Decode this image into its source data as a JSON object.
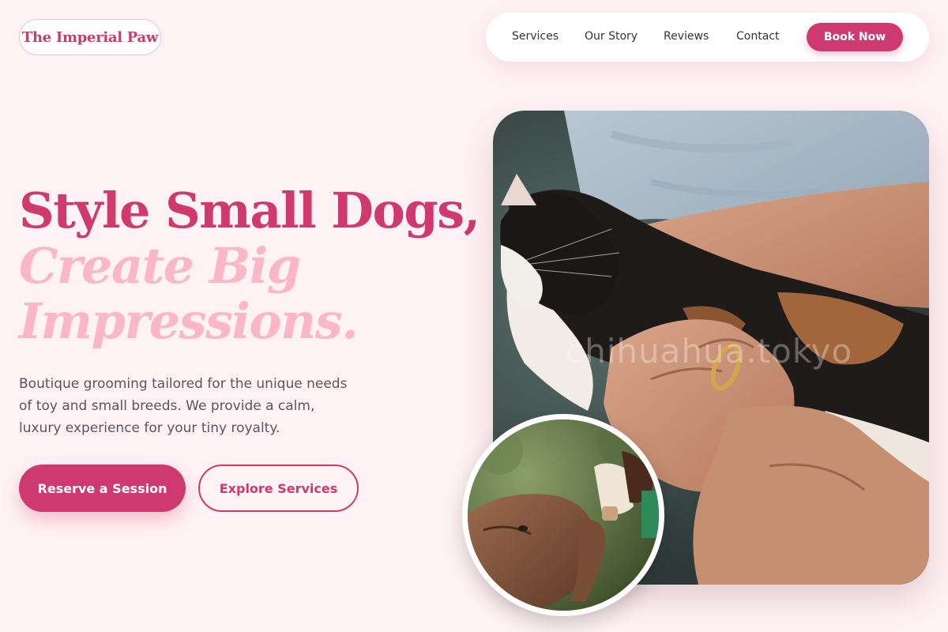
{
  "brand": {
    "name": "The Imperial Paw"
  },
  "nav": {
    "links": [
      "Services",
      "Our Story",
      "Reviews",
      "Contact"
    ],
    "cta": "Book Now"
  },
  "hero": {
    "headline_line1": "Style Small Dogs,",
    "headline_line2": "Create Big",
    "headline_line3": "Impressions.",
    "description_lines": [
      "Boutique grooming tailored for the unique needs",
      "of toy and small breeds. We provide a calm,",
      "luxury experience for your tiny royalty."
    ],
    "primary_button": "Reserve a Session",
    "secondary_button": "Explore Services",
    "photo_watermark": "chihuahua.tokyo"
  },
  "colors": {
    "accent": "#cf3a6e",
    "accent_light": "#f9b7c8",
    "background": "#fff2f4",
    "text": "#333333"
  }
}
